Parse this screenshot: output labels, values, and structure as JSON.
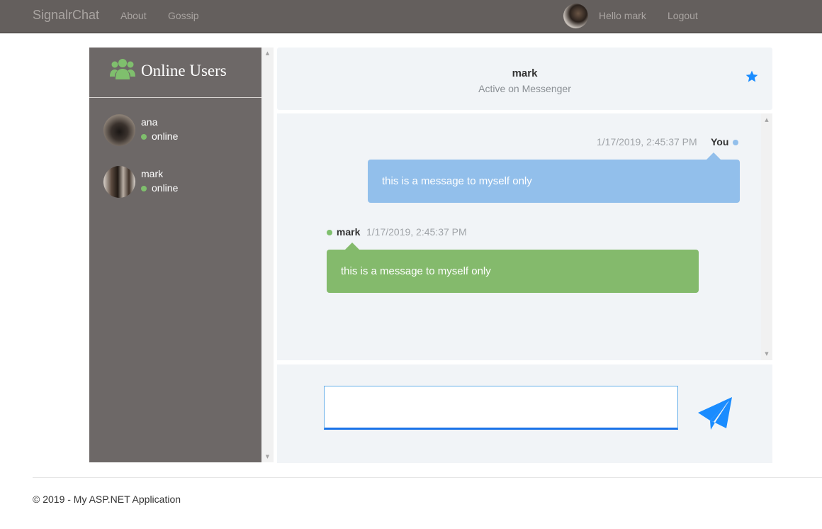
{
  "navbar": {
    "brand": "SignalrChat",
    "links": [
      "About",
      "Gossip"
    ],
    "greeting": "Hello mark",
    "logout": "Logout"
  },
  "sidebar": {
    "title": "Online Users",
    "icon": "users-icon",
    "users": [
      {
        "name": "ana",
        "status": "online"
      },
      {
        "name": "mark",
        "status": "online"
      }
    ]
  },
  "chat": {
    "contact_name": "mark",
    "contact_subtitle": "Active on Messenger",
    "messages": [
      {
        "author": "You",
        "timestamp": "1/17/2019, 2:45:37 PM",
        "text": "this is a message to myself only"
      },
      {
        "author": "mark",
        "timestamp": "1/17/2019, 2:45:37 PM",
        "text": "this is a message to myself only"
      }
    ],
    "input_value": ""
  },
  "footer": {
    "text": "© 2019 - My ASP.NET Application"
  },
  "colors": {
    "navbar": "#645f5d",
    "sidebar": "#6d6867",
    "online": "#7fbf6d",
    "mine_bubble": "#92bfeb",
    "theirs_bubble": "#84ba6c",
    "accent": "#1a8cff"
  }
}
